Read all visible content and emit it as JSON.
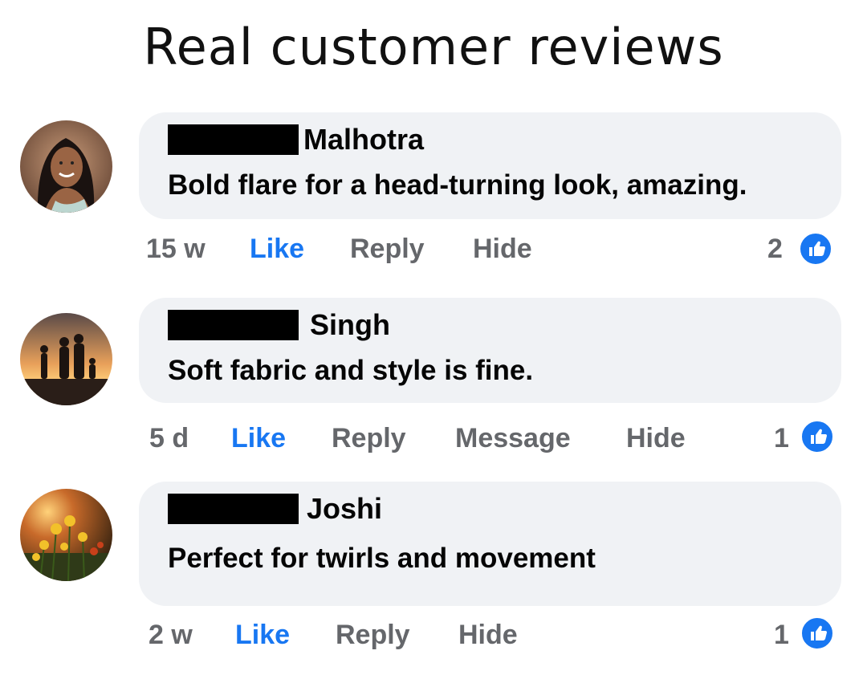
{
  "page": {
    "title": "Real customer reviews"
  },
  "reviews": [
    {
      "name": "Malhotra",
      "text": "Bold flare for a head-turning look, amazing.",
      "time": "15 w",
      "actions": [
        "Like",
        "Reply",
        "Hide"
      ],
      "reaction_count": "2",
      "avatar_icon": "woman-portrait-avatar"
    },
    {
      "name": "Singh",
      "text": "Soft fabric and style is fine.",
      "time": "5 d",
      "actions": [
        "Like",
        "Reply",
        "Message",
        "Hide"
      ],
      "reaction_count": "1",
      "avatar_icon": "family-sunset-avatar"
    },
    {
      "name": "Joshi",
      "text": "Perfect for twirls and movement",
      "time": "2 w",
      "actions": [
        "Like",
        "Reply",
        "Hide"
      ],
      "reaction_count": "1",
      "avatar_icon": "flowers-sunset-avatar"
    }
  ],
  "colors": {
    "bubble": "#f0f2f5",
    "like_blue": "#1877f2",
    "meta_gray": "#65676b"
  }
}
